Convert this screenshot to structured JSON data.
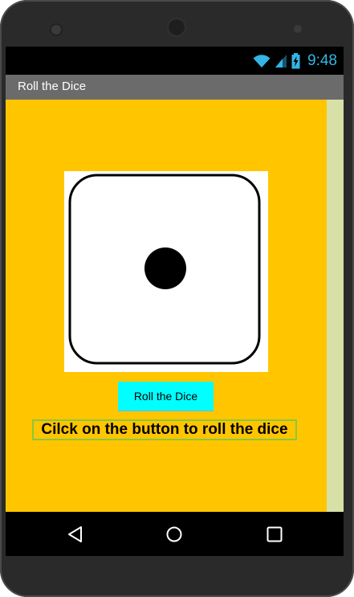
{
  "status_bar": {
    "time": "9:48",
    "icons": [
      "wifi-icon",
      "signal-icon",
      "battery-charging-icon"
    ],
    "accent_color": "#33b5e5"
  },
  "app": {
    "title": "Roll the Dice",
    "background_color": "#ffc600"
  },
  "dice": {
    "face_value": 1
  },
  "main": {
    "roll_button_label": "Roll the Dice",
    "roll_button_color": "#00ffff",
    "instruction_text": "Cilck on the button to roll the dice"
  },
  "nav_bar": {
    "icons": [
      "back-icon",
      "home-icon",
      "recents-icon"
    ]
  }
}
